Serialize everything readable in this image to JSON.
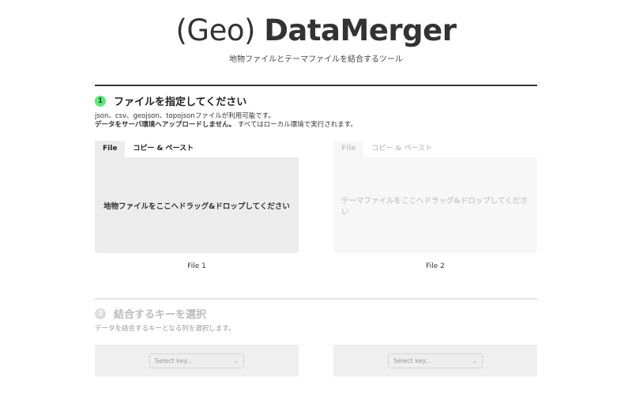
{
  "header": {
    "title_light": "(Geo) ",
    "title_bold": "DataMerger",
    "subtitle": "地物ファイルとテーマファイルを結合するツール"
  },
  "step1": {
    "number": "1",
    "title": "ファイルを指定してください",
    "description_line1": "json、csv、geojson、topojsonファイルが利用可能です。",
    "description_bold": "データをサーバ環境へアップロードしません。",
    "description_rest": " すべてはローカル環境で実行されます。",
    "panels": [
      {
        "tabs": [
          "File",
          "コピー & ペースト"
        ],
        "dropzone_text": "地物ファイルをここへドラッグ&ドロップしてください",
        "label": "File 1"
      },
      {
        "tabs": [
          "File",
          "コピー & ペースト"
        ],
        "dropzone_text": "テーマファイルをここへドラッグ&ドロップしてください",
        "label": "File 2"
      }
    ]
  },
  "step2": {
    "number": "2",
    "title": "結合するキーを選択",
    "description": "データを結合するキーとなる列を選択します。",
    "selects": [
      {
        "placeholder": "Select key..."
      },
      {
        "placeholder": "Select key..."
      }
    ]
  },
  "colors": {
    "step1_badge": "#5ee87c",
    "step2_badge": "#dddddd",
    "active_panel": "#ececec",
    "disabled_panel": "#f7f7f7"
  },
  "icons": {
    "select_chevron": "chevron-down-icon"
  }
}
